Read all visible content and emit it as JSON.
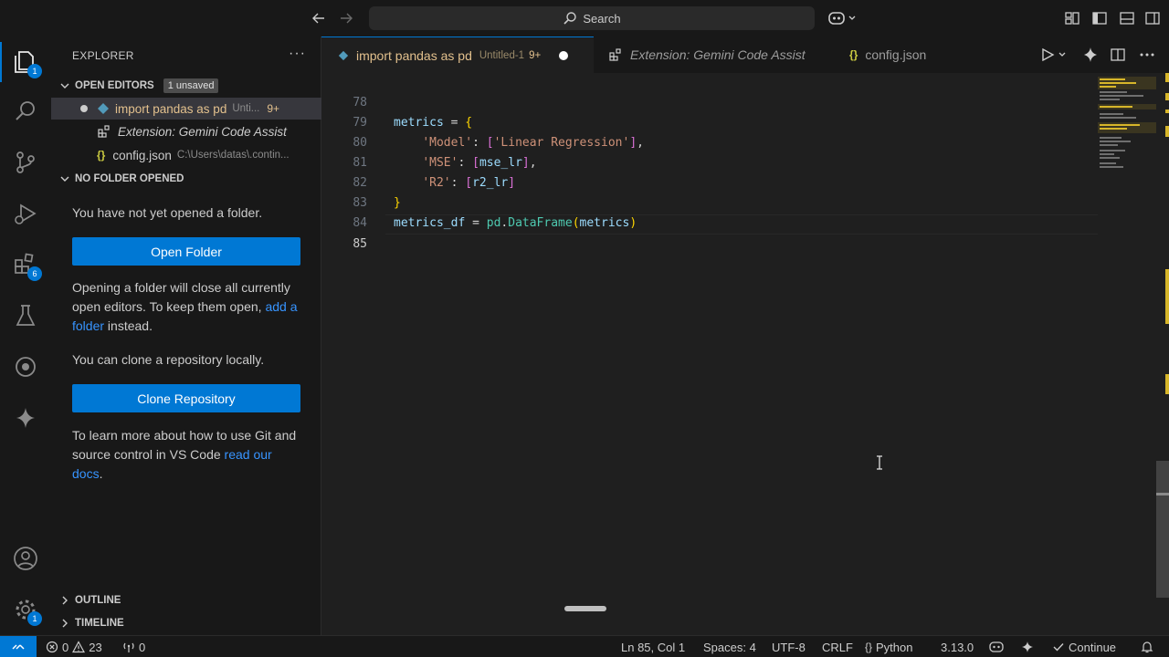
{
  "titlebar": {
    "search_placeholder": "Search",
    "icons": [
      "back-arrow-icon",
      "forward-arrow-icon",
      "search-icon",
      "copilot-icon",
      "customize-layout-icon",
      "toggle-primary-sidebar-icon",
      "toggle-panel-icon",
      "toggle-secondary-sidebar-icon"
    ]
  },
  "activitybar": {
    "explorer_badge": "1",
    "extensions_badge": "6",
    "settings_badge": "1"
  },
  "sidebar": {
    "title": "EXPLORER",
    "more": "···",
    "open_editors": {
      "header": "OPEN EDITORS",
      "badge": "1 unsaved",
      "items": [
        {
          "icon": "dot-modified-icon",
          "name": "import pandas as pd",
          "desc": "Unti...",
          "count": "9+"
        },
        {
          "icon": "extension-icon",
          "name": "Extension: Gemini Code Assist",
          "desc": ""
        },
        {
          "icon": "json-icon",
          "name": "config.json",
          "desc": "C:\\Users\\datas\\.contin..."
        }
      ]
    },
    "no_folder": {
      "header": "NO FOLDER OPENED",
      "msg1": "You have not yet opened a folder.",
      "open_folder_button": "Open Folder",
      "msg2_part1": "Opening a folder will close all currently open editors. To keep them open,",
      "msg2_link": "add a folder",
      "msg2_part2": "instead.",
      "msg3": "You can clone a repository locally.",
      "clone_button": "Clone Repository",
      "msg4_part1": "To learn more about how to use Git and source control in VS Code",
      "msg4_link": "read our docs",
      "msg4_part2": "."
    },
    "outline": "OUTLINE",
    "timeline": "TIMELINE"
  },
  "tabs": [
    {
      "label": "import pandas as pd",
      "desc": "Untitled-1",
      "count": "9+",
      "active": true
    },
    {
      "label": "Extension: Gemini Code Assist",
      "active": false
    },
    {
      "label": "config.json",
      "active": false
    }
  ],
  "editor": {
    "current_line": 85,
    "lines": [
      {
        "num": "78",
        "code": "metrics = {"
      },
      {
        "num": "79",
        "code": "    'Model': ['Linear Regression'],"
      },
      {
        "num": "80",
        "code": "    'MSE': [mse_lr],"
      },
      {
        "num": "81",
        "code": "    'R2': [r2_lr]"
      },
      {
        "num": "82",
        "code": "}"
      },
      {
        "num": "83",
        "code": "metrics_df = pd.DataFrame(metrics)"
      },
      {
        "num": "84",
        "code": ""
      },
      {
        "num": "85",
        "code": ""
      }
    ]
  },
  "statusbar": {
    "errors": "0",
    "warnings": "23",
    "ports": "0",
    "position": "Ln 85, Col 1",
    "spaces": "Spaces: 4",
    "encoding": "UTF-8",
    "eol": "CRLF",
    "language": "Python",
    "version": "3.13.0",
    "continue": "Continue"
  },
  "colors": {
    "accent": "#0078d4",
    "modified_tab": "#e2c08d",
    "link": "#3794ff"
  }
}
